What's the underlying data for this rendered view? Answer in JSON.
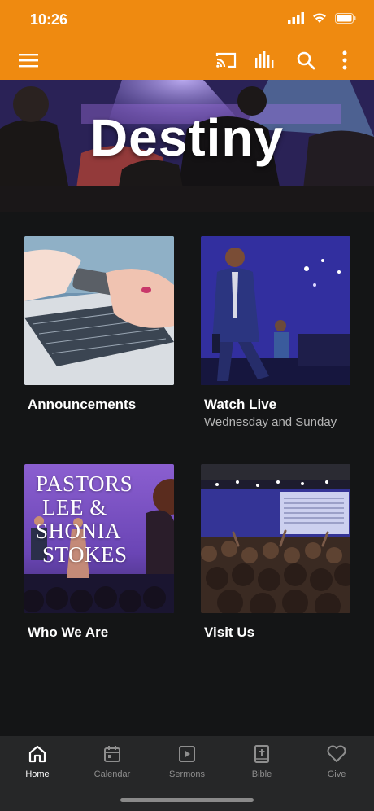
{
  "status": {
    "time": "10:26"
  },
  "colors": {
    "accent": "#ef8a10",
    "background": "#141516",
    "tab_bar": "#262728"
  },
  "app_bar": {
    "icons": [
      "menu-icon",
      "cast-icon",
      "equalizer-icon",
      "search-icon",
      "more-vert-icon"
    ]
  },
  "hero": {
    "title": "Destiny"
  },
  "tiles": [
    {
      "title": "Announcements",
      "subtitle": ""
    },
    {
      "title": "Watch Live",
      "subtitle": "Wednesday and Sunday"
    },
    {
      "title": "Who We Are",
      "subtitle": "",
      "image_text": [
        "PASTORS",
        "LEE &",
        "SHONIA",
        "STOKES"
      ]
    },
    {
      "title": "Visit Us",
      "subtitle": ""
    }
  ],
  "tabs": [
    {
      "label": "Home",
      "icon": "home-icon",
      "active": true
    },
    {
      "label": "Calendar",
      "icon": "calendar-icon",
      "active": false
    },
    {
      "label": "Sermons",
      "icon": "play-icon",
      "active": false
    },
    {
      "label": "Bible",
      "icon": "bible-icon",
      "active": false
    },
    {
      "label": "Give",
      "icon": "heart-icon",
      "active": false
    }
  ]
}
